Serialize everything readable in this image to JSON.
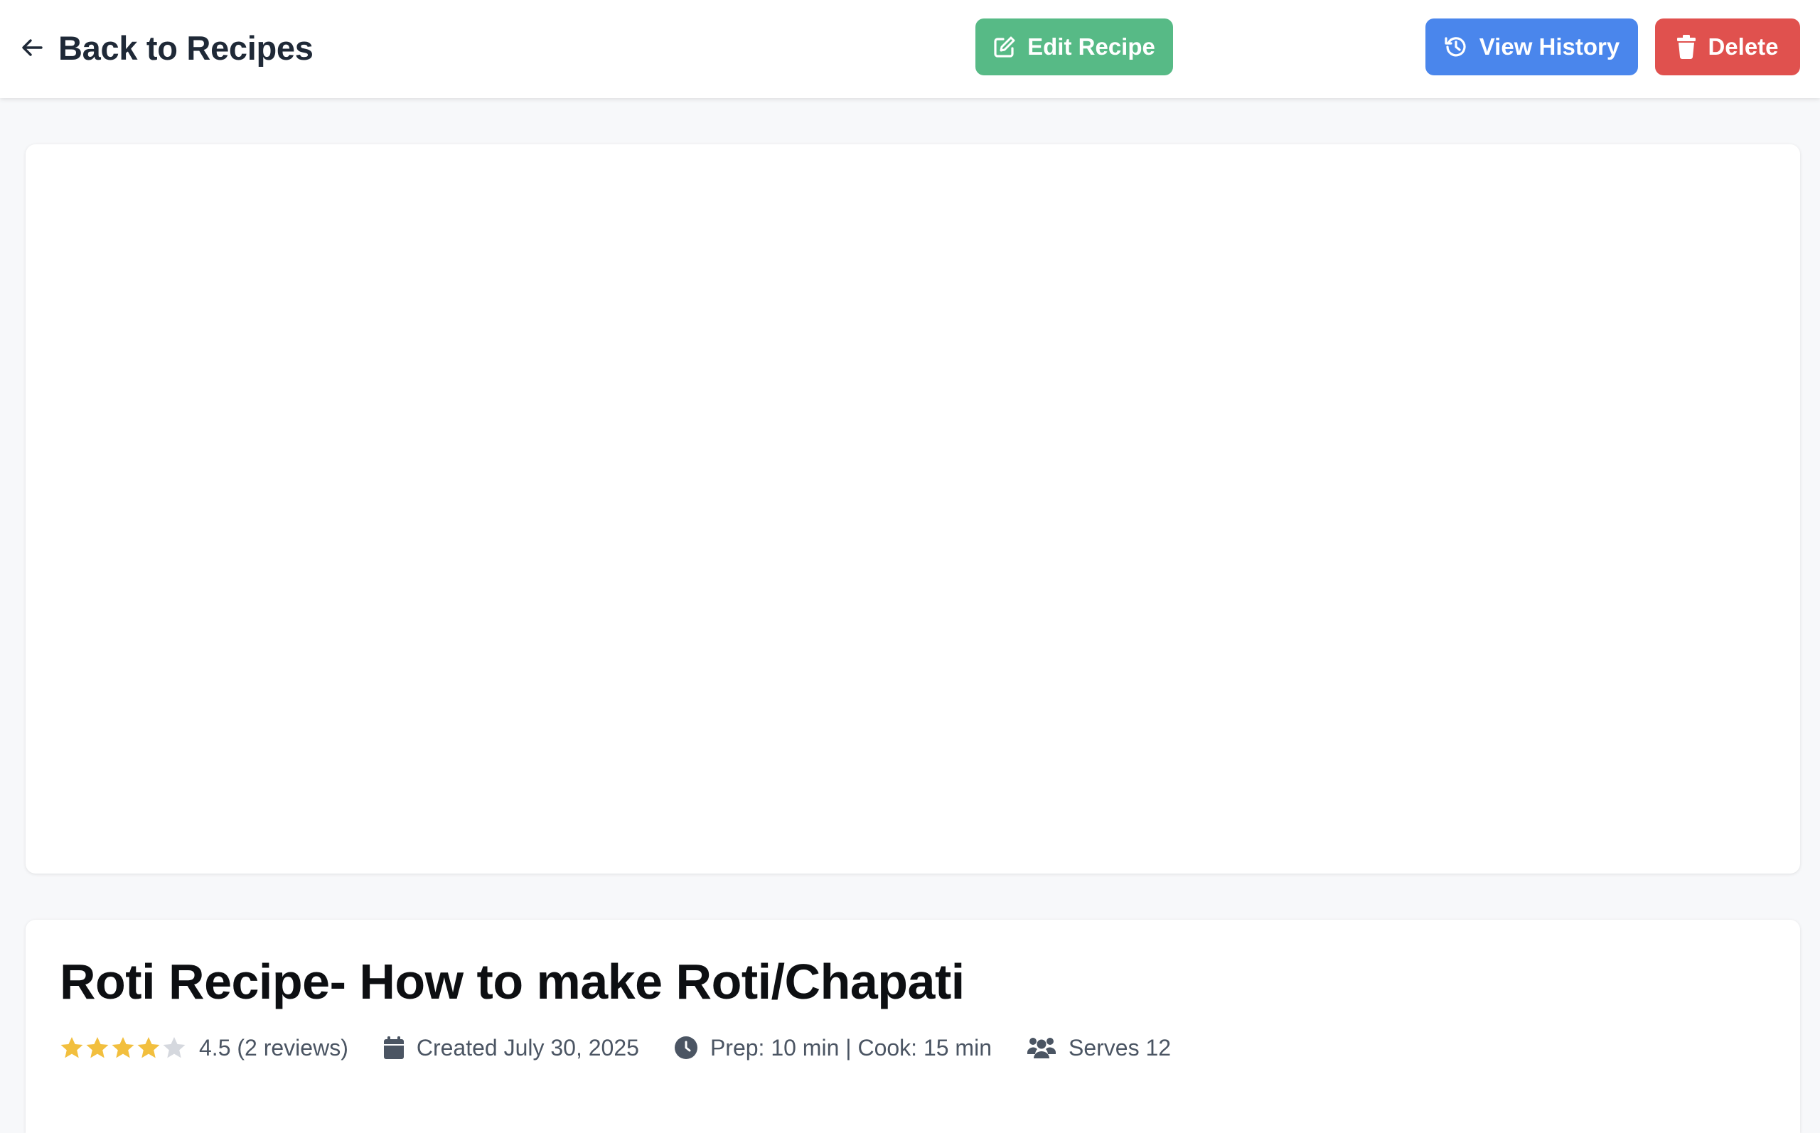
{
  "header": {
    "back_label": "Back to Recipes",
    "edit_label": "Edit Recipe",
    "history_label": "View History",
    "delete_label": "Delete"
  },
  "colors": {
    "edit_button": "#57ba86",
    "history_button": "#4a86ec",
    "delete_button": "#e0514e",
    "star_filled": "#f2bf3e",
    "star_empty": "#d5d8de"
  },
  "recipe": {
    "title": "Roti Recipe- How to make Roti/Chapati",
    "rating_value": 4.5,
    "rating_text": "4.5 (2 reviews)",
    "created_text": "Created July 30, 2025",
    "time_text": "Prep: 10 min | Cook: 15 min",
    "serves_text": "Serves 12"
  },
  "icons": {
    "back": "arrow-left-icon",
    "edit": "edit-icon",
    "history": "history-icon",
    "delete": "trash-icon",
    "calendar": "calendar-icon",
    "clock": "clock-icon",
    "users": "users-icon",
    "star": "star-icon"
  }
}
